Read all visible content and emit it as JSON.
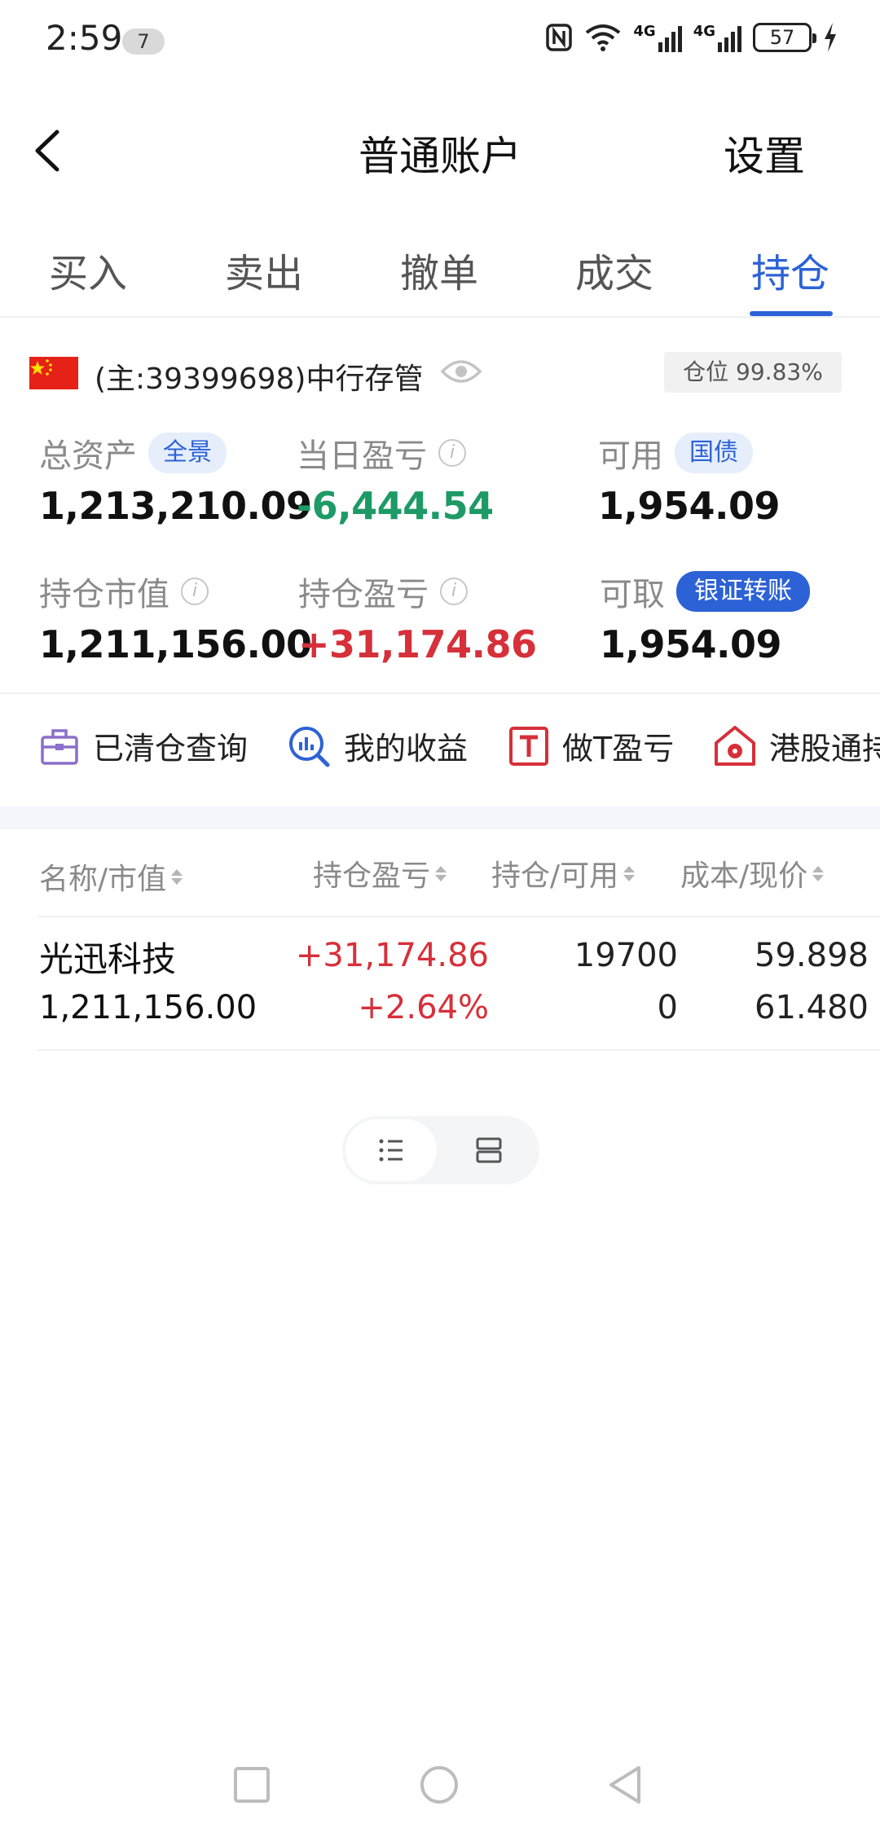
{
  "status_bar": {
    "time": "2:59",
    "notification_count": "7",
    "network_1": "4G",
    "network_2": "4G",
    "battery": "57"
  },
  "header": {
    "title": "普通账户",
    "settings_label": "设置"
  },
  "tabs": [
    {
      "label": "买入"
    },
    {
      "label": "卖出"
    },
    {
      "label": "撤单"
    },
    {
      "label": "成交"
    },
    {
      "label": "持仓",
      "active": true
    }
  ],
  "account": {
    "label": "(主:39399698)中行存管",
    "position_ratio": "仓位 99.83%"
  },
  "stats": {
    "total_assets": {
      "label": "总资产",
      "tag": "全景",
      "value": "1,213,210.09"
    },
    "daily_pnl": {
      "label": "当日盈亏",
      "value": "-6,444.54"
    },
    "available": {
      "label": "可用",
      "tag": "国债",
      "value": "1,954.09"
    },
    "market_value": {
      "label": "持仓市值",
      "value": "1,211,156.00"
    },
    "holding_pnl": {
      "label": "持仓盈亏",
      "value": "+31,174.86"
    },
    "withdrawable": {
      "label": "可取",
      "tag": "银证转账",
      "value": "1,954.09"
    }
  },
  "shortcuts": [
    {
      "label": "已清仓查询",
      "icon": "briefcase-icon"
    },
    {
      "label": "我的收益",
      "icon": "chart-search-icon"
    },
    {
      "label": "做T盈亏",
      "icon": "t-box-icon"
    },
    {
      "label": "港股通持",
      "icon": "hk-flower-icon"
    }
  ],
  "table": {
    "headers": [
      "名称/市值",
      "持仓盈亏",
      "持仓/可用",
      "成本/现价"
    ],
    "rows": [
      {
        "name": "光迅科技",
        "market_value": "1,211,156.00",
        "pnl": "+31,174.86",
        "pnl_pct": "+2.64%",
        "holding": "19700",
        "available": "0",
        "cost": "59.898",
        "price": "61.480"
      }
    ]
  },
  "colors": {
    "accent": "#2c62d6",
    "up": "#d6303a",
    "down": "#1d9a66"
  }
}
